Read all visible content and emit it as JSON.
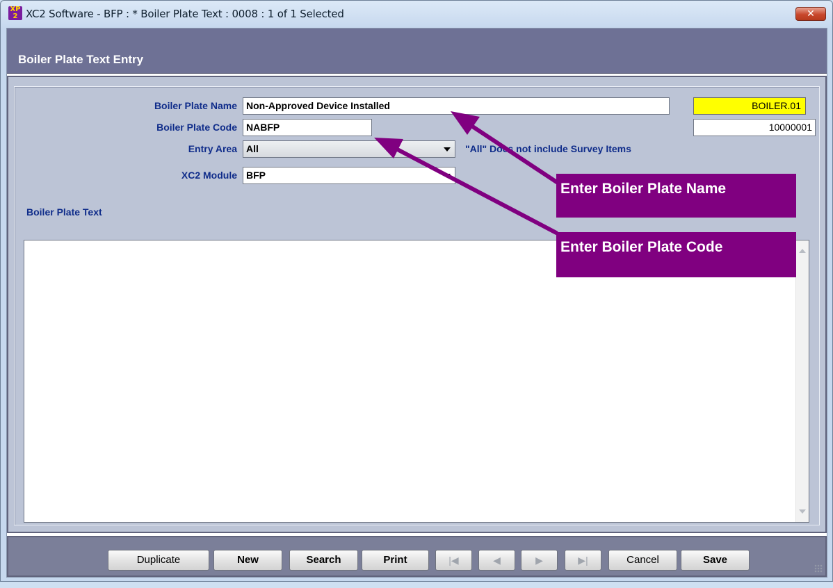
{
  "window": {
    "title": "XC2 Software - BFP : * Boiler Plate Text : 0008 : 1 of 1 Selected",
    "app_icon_top": "XP",
    "app_icon_bottom": "2",
    "close_symbol": "✕"
  },
  "header": {
    "title": "Boiler Plate Text Entry"
  },
  "form": {
    "name_label": "Boiler Plate Name",
    "name_value": "Non-Approved Device Installed",
    "code_label": "Boiler Plate Code",
    "code_value": "NABFP",
    "entry_area_label": "Entry Area",
    "entry_area_value": "All",
    "entry_area_note": "\"All\" Does not include Survey Items",
    "module_label": "XC2 Module",
    "module_value": "BFP",
    "record_code": "BOILER.01",
    "record_number": "10000001",
    "text_label": "Boiler Plate Text",
    "text_value": ""
  },
  "footer": {
    "duplicate": "Duplicate",
    "new": "New",
    "search": "Search",
    "print": "Print",
    "first": "|◀",
    "prev": "◀",
    "next": "▶",
    "last": "▶|",
    "cancel": "Cancel",
    "save": "Save"
  },
  "annotations": {
    "callout_name": "Enter Boiler Plate Name",
    "callout_code": "Enter Boiler Plate Code",
    "color": "#800080"
  }
}
